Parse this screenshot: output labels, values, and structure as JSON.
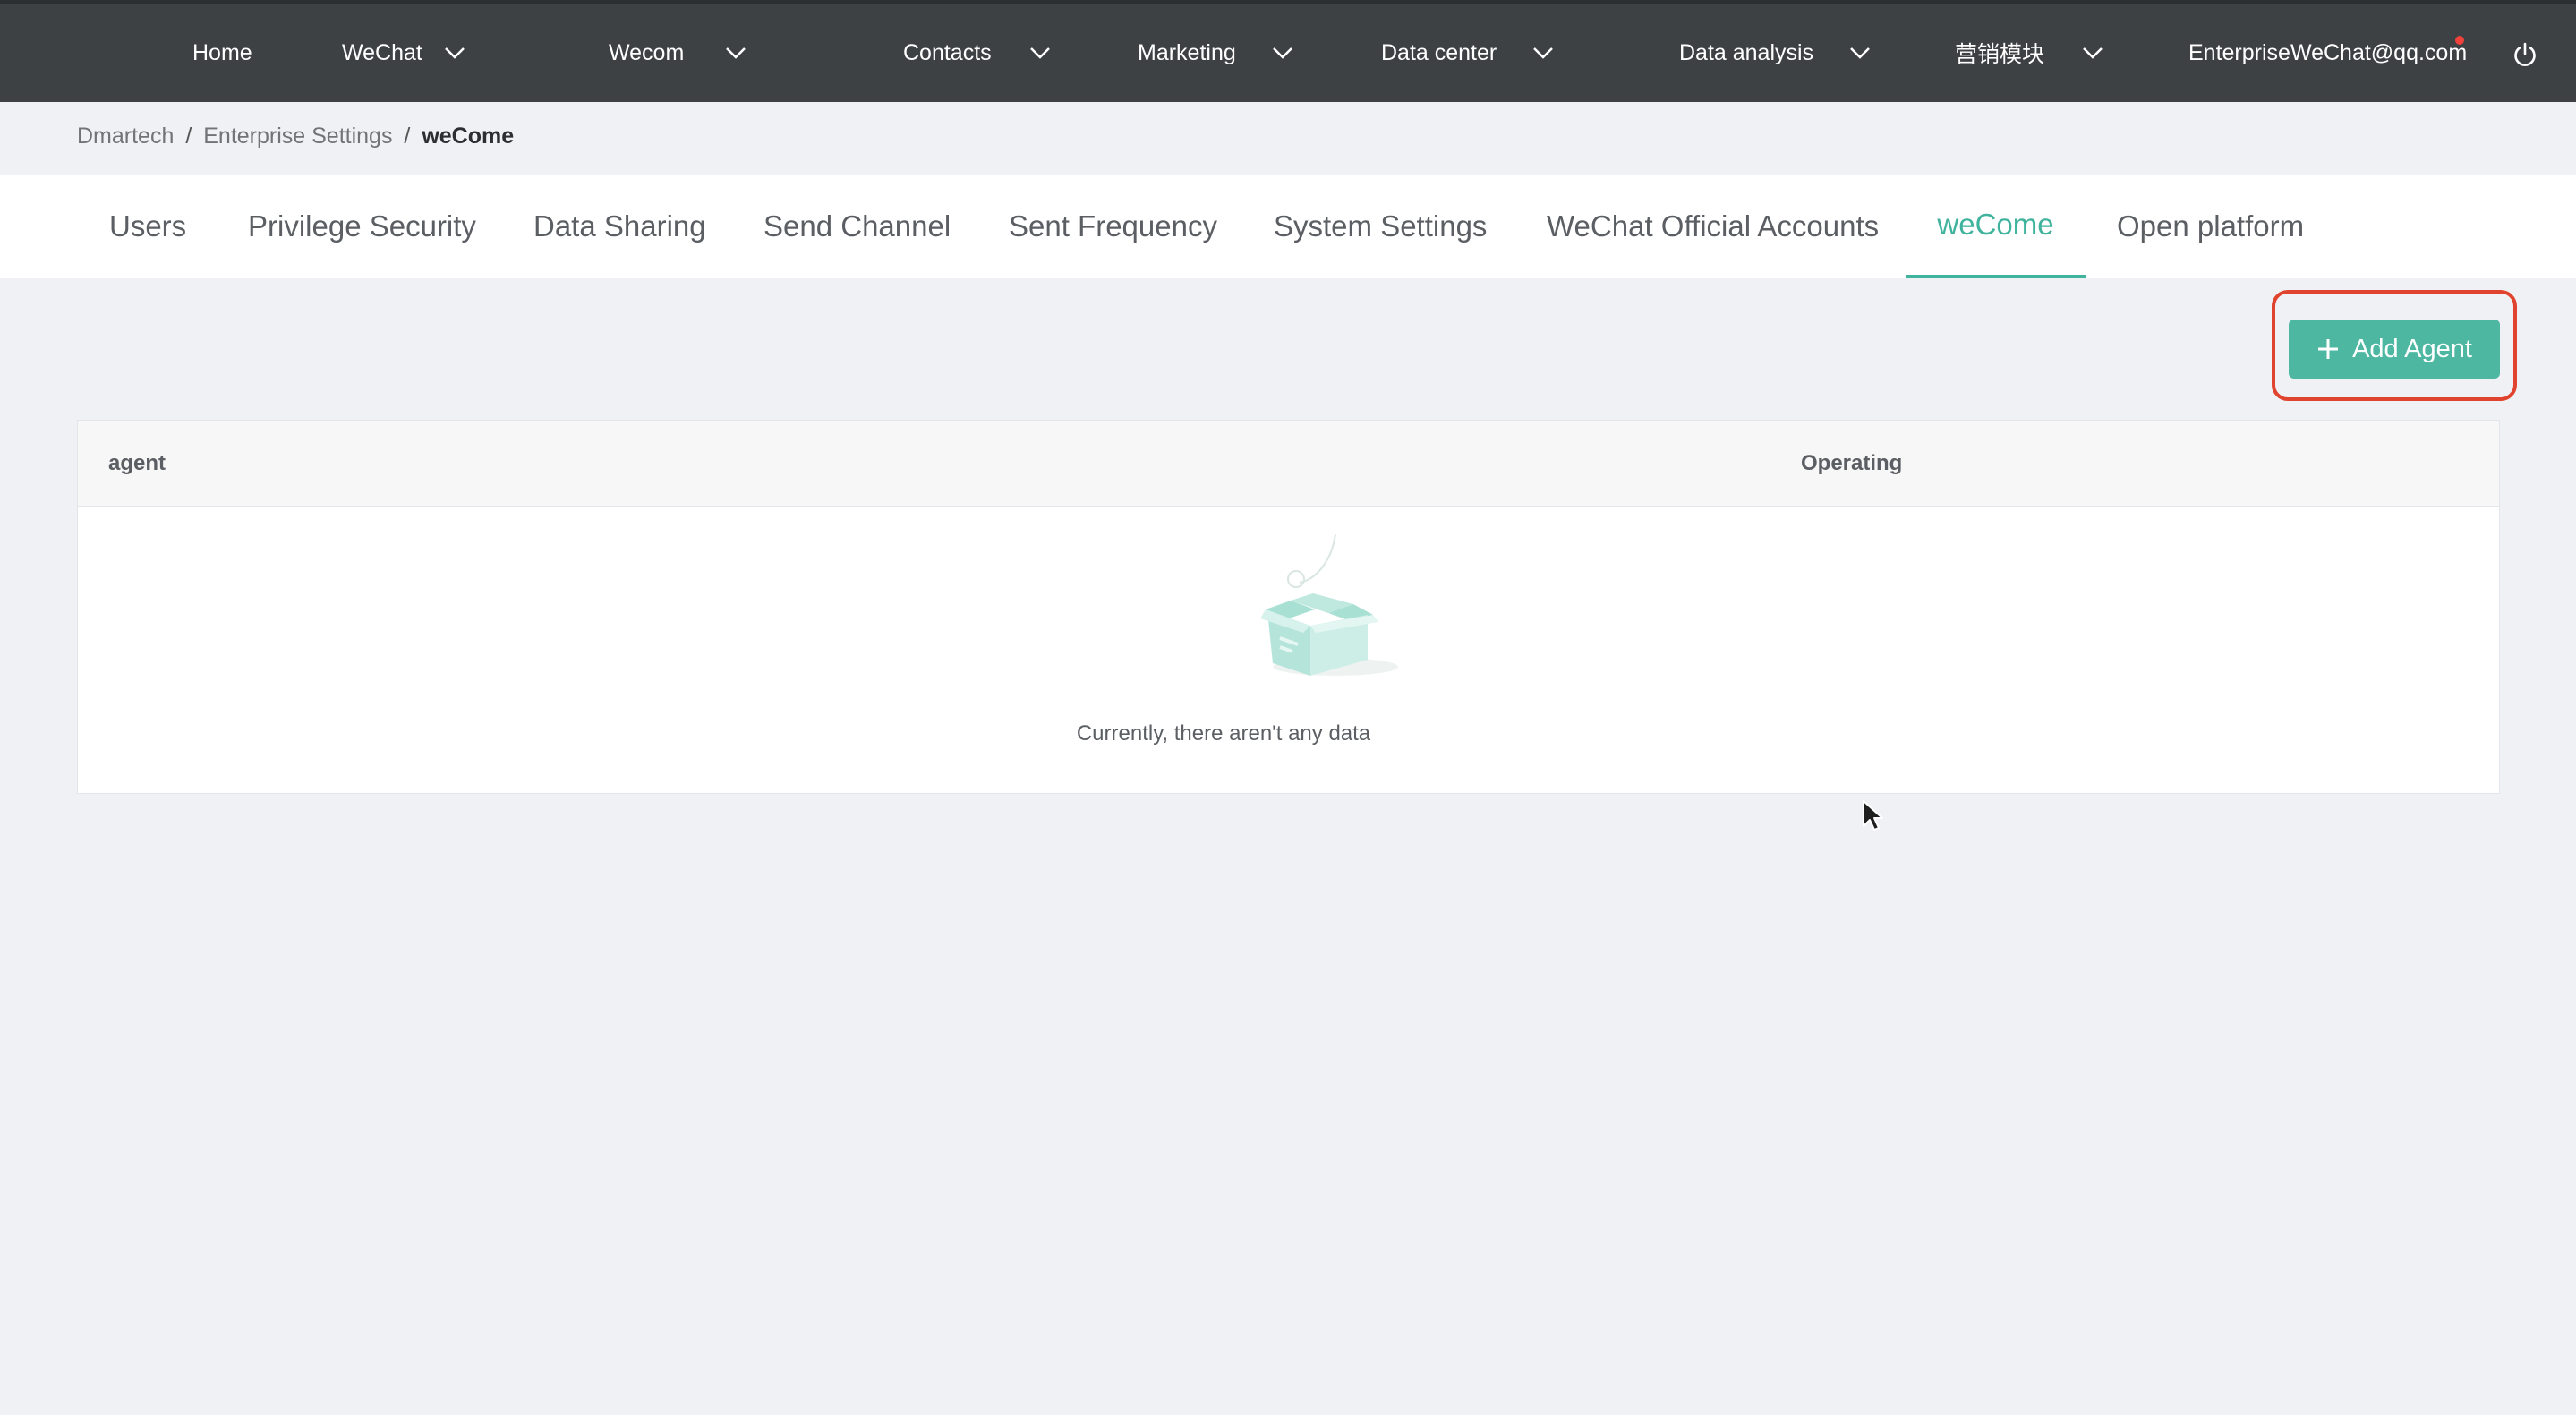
{
  "nav": {
    "items": [
      {
        "label": "Home",
        "has_dropdown": false
      },
      {
        "label": "WeChat",
        "has_dropdown": true
      },
      {
        "label": "Wecom",
        "has_dropdown": true
      },
      {
        "label": "Contacts",
        "has_dropdown": true
      },
      {
        "label": "Marketing",
        "has_dropdown": true
      },
      {
        "label": "Data center",
        "has_dropdown": true
      },
      {
        "label": "Data analysis",
        "has_dropdown": true
      },
      {
        "label": "营销模块",
        "has_dropdown": true
      }
    ],
    "user_email": "EnterpriseWeChat@qq.com",
    "has_notification": true,
    "power_icon": "power-icon"
  },
  "breadcrumb": {
    "items": [
      "Dmartech",
      "Enterprise Settings"
    ],
    "current": "weCome",
    "separator": "/"
  },
  "tabs": {
    "items": [
      {
        "label": "Users",
        "active": false
      },
      {
        "label": "Privilege Security",
        "active": false
      },
      {
        "label": "Data Sharing",
        "active": false
      },
      {
        "label": "Send Channel",
        "active": false
      },
      {
        "label": "Sent Frequency",
        "active": false
      },
      {
        "label": "System Settings",
        "active": false
      },
      {
        "label": "WeChat Official Accounts",
        "active": false
      },
      {
        "label": "weCome",
        "active": true
      },
      {
        "label": "Open platform",
        "active": false
      }
    ]
  },
  "toolbar": {
    "add_agent_label": "Add Agent",
    "add_icon": "plus-icon"
  },
  "table": {
    "columns": [
      "agent",
      "Operating"
    ],
    "rows": [],
    "empty_text": "Currently, there aren't any data",
    "empty_icon": "empty-box-icon"
  },
  "colors": {
    "topbar": "#3d4144",
    "accent": "#3fb39d",
    "button": "#4db7a2",
    "highlight": "#e0442e",
    "page_bg": "#f0f1f5"
  }
}
